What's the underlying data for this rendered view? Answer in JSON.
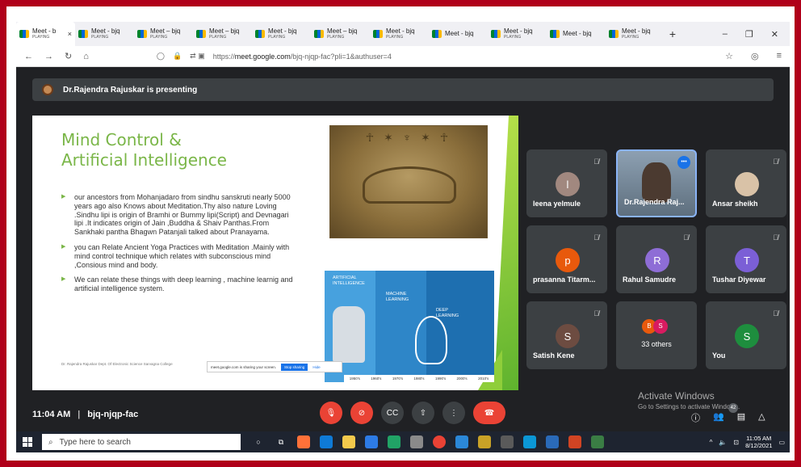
{
  "browser": {
    "tabs": [
      {
        "title": "Meet - b",
        "sub": "PLAYING",
        "active": true
      },
      {
        "title": "Meet - bjq",
        "sub": "PLAYING"
      },
      {
        "title": "Meet – bjq",
        "sub": "PLAYING"
      },
      {
        "title": "Meet – bjq",
        "sub": "PLAYING"
      },
      {
        "title": "Meet - bjq",
        "sub": "PLAYING"
      },
      {
        "title": "Meet – bjq",
        "sub": "PLAYING"
      },
      {
        "title": "Meet - bjq",
        "sub": "PLAYING"
      },
      {
        "title": "Meet - bjq",
        "sub": ""
      },
      {
        "title": "Meet - bjq",
        "sub": "PLAYING"
      },
      {
        "title": "Meet - bjq",
        "sub": ""
      },
      {
        "title": "Meet - bjq",
        "sub": "PLAYING"
      }
    ],
    "tab_close": "×",
    "new_tab": "+",
    "win_min": "–",
    "win_max": "❐",
    "win_close": "✕",
    "url_prefix": "https://",
    "url_domain": "meet.google.com",
    "url_path": "/bjq-njqp-fac?pli=1&authuser=4"
  },
  "presenter_bar": {
    "text": "Dr.Rajendra Rajuskar is presenting"
  },
  "slide": {
    "title_line1": "Mind Control &",
    "title_line2": "Artificial Intelligence",
    "bullets": [
      "our ancestors from Mohanjadaro from sindhu sanskruti nearly 5000 years ago also Knows about Meditation.Thy also nature Loving .Sindhu lipi is origin of Bramhi or Bummy lipi(Script) and Devnagari lipi .It indicates origin of Jain ,Buddha & Shaiv Panthas.From Sankhaki pantha Bhagwn Patanjali talked about Pranayama.",
      "you can Relate Ancient Yoga Practices with Meditation .Mainly with mind control technique which relates with subconscious mind ,Consious mind and body.",
      "We can relate these things with deep learning , machine learnig and artificial intelligence system."
    ],
    "footer": "Dr. Rajendra Rajuskar Dept. Of Electronic Science Sarvagna College",
    "diagram": {
      "ai_label": "ARTIFICIAL INTELLIGENCE",
      "ml_label": "MACHINE LEARNING",
      "dl_label": "DEEP LEARNING",
      "years": [
        "1950's",
        "1960's",
        "1970's",
        "1980's",
        "1990's",
        "2000's",
        "2010's"
      ]
    },
    "share_text": "meet.google.com is sharing your screen.",
    "stop_sharing": "Stop sharing",
    "hide": "Hide"
  },
  "participants": [
    {
      "name": "leena yelmule",
      "initial": "l",
      "color": "#a1887f"
    },
    {
      "name": "Dr.Rajendra Raj...",
      "video": true
    },
    {
      "name": "Ansar sheikh",
      "photo": true
    },
    {
      "name": "prasanna Titarm...",
      "initial": "p",
      "color": "#e8590c"
    },
    {
      "name": "Rahul Samudre",
      "initial": "R",
      "color": "#8e6dd6"
    },
    {
      "name": "Tushar Diyewar",
      "initial": "T",
      "color": "#7b5fd6"
    },
    {
      "name": "Satish Kene",
      "initial": "S",
      "color": "#6d4c41"
    },
    {
      "name": "33 others",
      "others": [
        "B",
        "S"
      ]
    },
    {
      "name": "You",
      "initial": "S",
      "color": "#1e8e3e"
    }
  ],
  "meeting": {
    "time": "11:04 AM",
    "separator": "|",
    "code": "bjq-njqp-fac"
  },
  "people_count": "42",
  "watermark": {
    "title": "Activate Windows",
    "sub": "Go to Settings to activate Windows."
  },
  "taskbar": {
    "search_placeholder": "Type here to search",
    "time": "11:05 AM",
    "date": "8/12/2021"
  },
  "colors": {
    "accent": "#7ab648",
    "danger": "#ea4335",
    "meet_bg": "#202124",
    "tile_bg": "#3c4043"
  }
}
